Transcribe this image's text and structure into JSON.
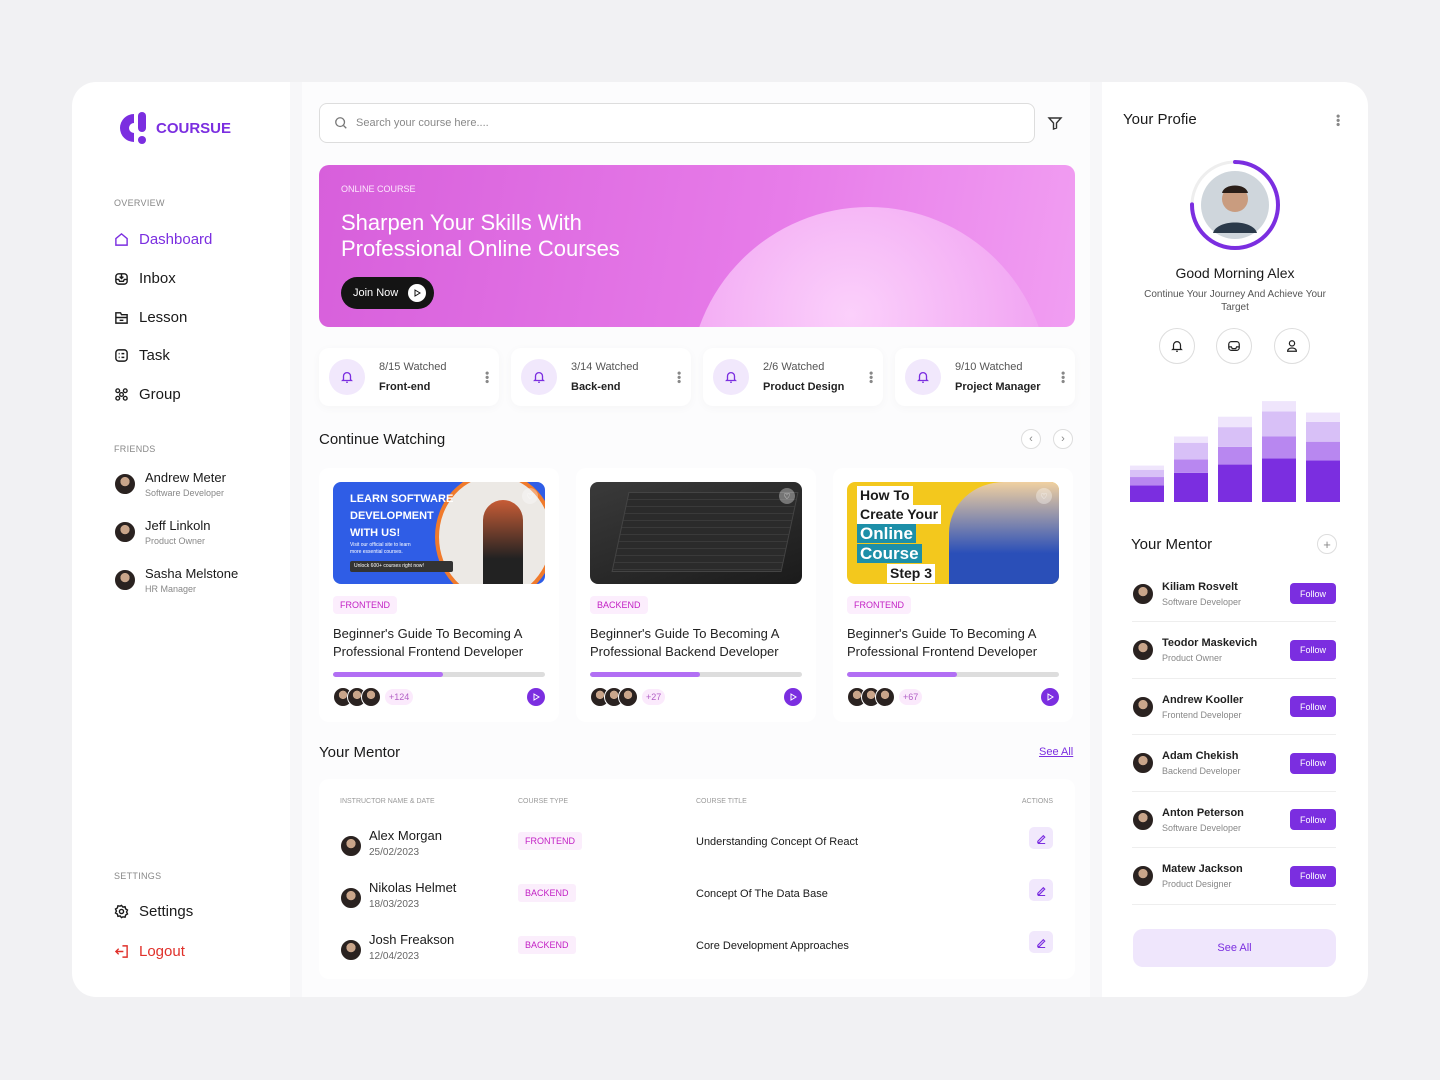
{
  "brand": {
    "name": "COURSUE",
    "accent": "#7b2ee0"
  },
  "sidebar": {
    "overview_label": "OVERVIEW",
    "items": [
      {
        "label": "Dashboard",
        "icon": "home-icon"
      },
      {
        "label": "Inbox",
        "icon": "inbox-icon"
      },
      {
        "label": "Lesson",
        "icon": "folder-icon"
      },
      {
        "label": "Task",
        "icon": "task-icon"
      },
      {
        "label": "Group",
        "icon": "group-icon"
      }
    ],
    "friends_label": "FRIENDS",
    "friends": [
      {
        "name": "Andrew Meter",
        "role": "Software Developer"
      },
      {
        "name": "Jeff Linkoln",
        "role": "Product Owner"
      },
      {
        "name": "Sasha Melstone",
        "role": "HR Manager"
      }
    ],
    "settings_label": "SETTINGS",
    "settings": "Settings",
    "logout": "Logout"
  },
  "search": {
    "placeholder": "Search your course here...."
  },
  "hero": {
    "tag": "ONLINE COURSE",
    "title": "Sharpen Your Skills With Professional Online Courses",
    "button": "Join Now"
  },
  "stats": [
    {
      "watched": "8/15 Watched",
      "name": "Front-end"
    },
    {
      "watched": "3/14 Watched",
      "name": "Back-end"
    },
    {
      "watched": "2/6 Watched",
      "name": "Product Design"
    },
    {
      "watched": "9/10 Watched",
      "name": "Project Manager"
    }
  ],
  "continue": {
    "title": "Continue Watching",
    "courses": [
      {
        "type": "FRONTEND",
        "title": "Beginner's Guide To Becoming A Professional Frontend Developer",
        "progress": 52,
        "more": "+124",
        "thumb": {
          "line1": "LEARN SOFTWARE",
          "line2": "DEVELOPMENT",
          "line3": "WITH US!",
          "sub": "Visit our official site to learn more essential courses.",
          "cta": "Unlock 600+ courses right now!"
        }
      },
      {
        "type": "BACKEND",
        "title": "Beginner's Guide To Becoming A Professional Backend Developer",
        "progress": 52,
        "more": "+27"
      },
      {
        "type": "FRONTEND",
        "title": "Beginner's Guide To Becoming A Professional Frontend Developer",
        "progress": 52,
        "more": "+67",
        "thumb": {
          "line1": "How To",
          "line2": "Create Your",
          "line3": "Online",
          "line4": "Course",
          "line5": "Step 3"
        }
      }
    ]
  },
  "mentor_table": {
    "title": "Your Mentor",
    "see_all": "See All",
    "columns": [
      "INSTRUCTOR NAME & DATE",
      "COURSE TYPE",
      "COURSE TITLE",
      "ACTIONS"
    ],
    "rows": [
      {
        "name": "Alex Morgan",
        "date": "25/02/2023",
        "type": "FRONTEND",
        "course": "Understanding Concept Of React"
      },
      {
        "name": "Nikolas Helmet",
        "date": "18/03/2023",
        "type": "BACKEND",
        "course": "Concept Of The Data Base"
      },
      {
        "name": "Josh Freakson",
        "date": "12/04/2023",
        "type": "BACKEND",
        "course": "Core Development Approaches"
      }
    ]
  },
  "profile": {
    "title": "Your Profie",
    "greeting": "Good Morning Alex",
    "subtitle": "Continue Your Journey And Achieve Your Target",
    "progress_ring": 75
  },
  "chart_data": {
    "type": "bar",
    "stacked": true,
    "categories": [
      "1",
      "2",
      "3",
      "4",
      "5"
    ],
    "series": [
      {
        "values": [
          16,
          28,
          36,
          42,
          40
        ]
      },
      {
        "values": [
          8,
          13,
          17,
          21,
          18
        ]
      },
      {
        "values": [
          7,
          16,
          19,
          24,
          19
        ]
      },
      {
        "values": [
          4,
          6,
          10,
          10,
          9
        ]
      }
    ],
    "colors": [
      "#7b2ee0",
      "#b887f0",
      "#d8c0f7",
      "#efe5fc"
    ]
  },
  "mentors": {
    "title": "Your Mentor",
    "follow": "Follow",
    "see_all": "See All",
    "items": [
      {
        "name": "Kiliam Rosvelt",
        "role": "Software Developer"
      },
      {
        "name": "Teodor Maskevich",
        "role": "Product Owner"
      },
      {
        "name": "Andrew Kooller",
        "role": "Frontend Developer"
      },
      {
        "name": "Adam Chekish",
        "role": "Backend Developer"
      },
      {
        "name": "Anton Peterson",
        "role": "Software Developer"
      },
      {
        "name": "Matew Jackson",
        "role": "Product Designer"
      }
    ]
  }
}
